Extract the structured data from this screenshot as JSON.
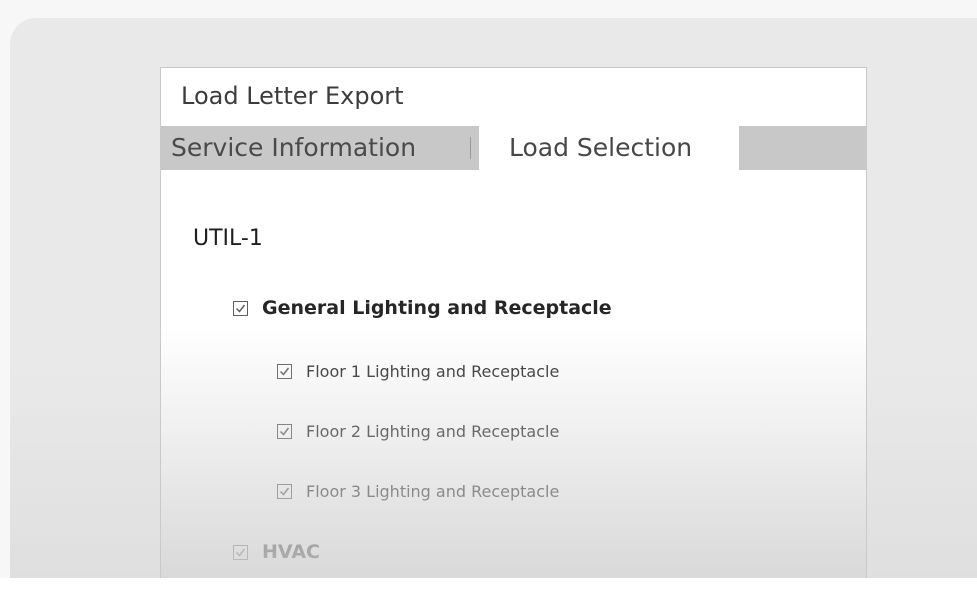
{
  "dialog": {
    "title": "Load Letter Export"
  },
  "tabs": [
    {
      "label": "Service Information",
      "active": false
    },
    {
      "label": "Load Selection",
      "active": true
    }
  ],
  "load_selection": {
    "service_name": "UTIL-1",
    "items": [
      {
        "label": "General Lighting and Receptacle",
        "checked": true,
        "level": 1
      },
      {
        "label": "Floor 1 Lighting and Receptacle",
        "checked": true,
        "level": 2
      },
      {
        "label": "Floor 2 Lighting and Receptacle",
        "checked": true,
        "level": 2
      },
      {
        "label": "Floor 3 Lighting and Receptacle",
        "checked": true,
        "level": 2
      },
      {
        "label": "HVAC",
        "checked": true,
        "level": 1
      }
    ]
  },
  "icons": {
    "checkbox": "checkmark-icon"
  },
  "colors": {
    "tab_strip": "#c8c8c8",
    "background_panel": "#e9e9e9",
    "dialog": "#ffffff"
  }
}
